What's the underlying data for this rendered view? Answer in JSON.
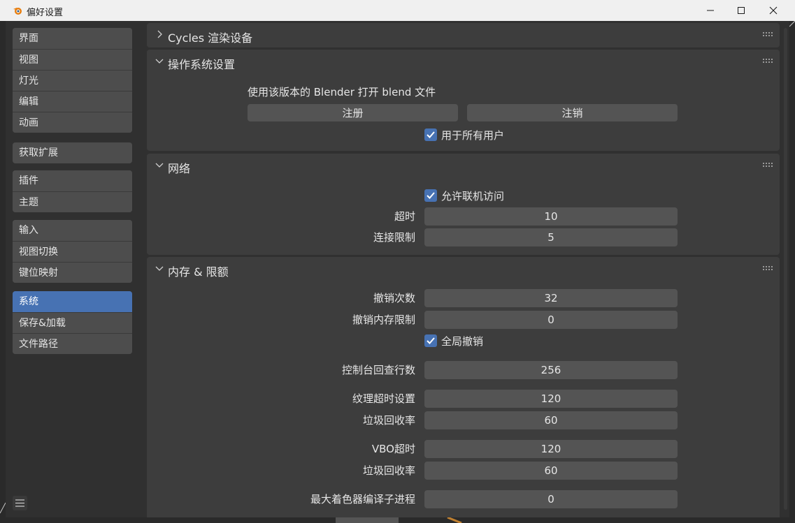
{
  "window": {
    "title": "偏好设置",
    "icon": "blender-icon",
    "controls": [
      "minimize-icon",
      "maximize-icon",
      "close-icon"
    ]
  },
  "sidebar": {
    "groups": [
      {
        "items": [
          {
            "label": "界面"
          },
          {
            "label": "视图"
          },
          {
            "label": "灯光"
          },
          {
            "label": "编辑"
          },
          {
            "label": "动画"
          }
        ]
      },
      {
        "items": [
          {
            "label": "获取扩展"
          }
        ]
      },
      {
        "items": [
          {
            "label": "插件"
          },
          {
            "label": "主题"
          }
        ]
      },
      {
        "items": [
          {
            "label": "输入"
          },
          {
            "label": "视图切换"
          },
          {
            "label": "键位映射"
          }
        ]
      },
      {
        "items": [
          {
            "label": "系统",
            "active": true
          },
          {
            "label": "保存&加载"
          },
          {
            "label": "文件路径"
          }
        ]
      }
    ],
    "menu_icon": "hamburger-menu-icon"
  },
  "panels": {
    "cycles": {
      "title": "Cycles 渲染设备",
      "collapsed": true
    },
    "os": {
      "title": "操作系统设置",
      "description": "使用该版本的 Blender 打开 blend 文件",
      "register_label": "注册",
      "unregister_label": "注销",
      "all_users_label": "用于所有用户",
      "all_users_checked": true
    },
    "network": {
      "title": "网络",
      "online_access_label": "允许联机访问",
      "online_access_checked": true,
      "timeout_label": "超时",
      "timeout_value": "10",
      "connection_limit_label": "连接限制",
      "connection_limit_value": "5"
    },
    "memory": {
      "title": "内存 & 限额",
      "undo_steps_label": "撤销次数",
      "undo_steps_value": "32",
      "undo_memory_label": "撤销内存限制",
      "undo_memory_value": "0",
      "global_undo_label": "全局撤销",
      "global_undo_checked": true,
      "console_scrollback_label": "控制台回查行数",
      "console_scrollback_value": "256",
      "texture_timeout_label": "纹理超时设置",
      "texture_timeout_value": "120",
      "texture_gc_label": "垃圾回收率",
      "texture_gc_value": "60",
      "vbo_timeout_label": "VBO超时",
      "vbo_timeout_value": "120",
      "vbo_gc_label": "垃圾回收率",
      "vbo_gc_value": "60",
      "shader_compile_label": "最大着色器编译子进程",
      "shader_compile_value": "0"
    }
  },
  "colors": {
    "accent": "#4772b3",
    "panel": "#3d3d3d",
    "field": "#545454",
    "background": "#303030"
  }
}
